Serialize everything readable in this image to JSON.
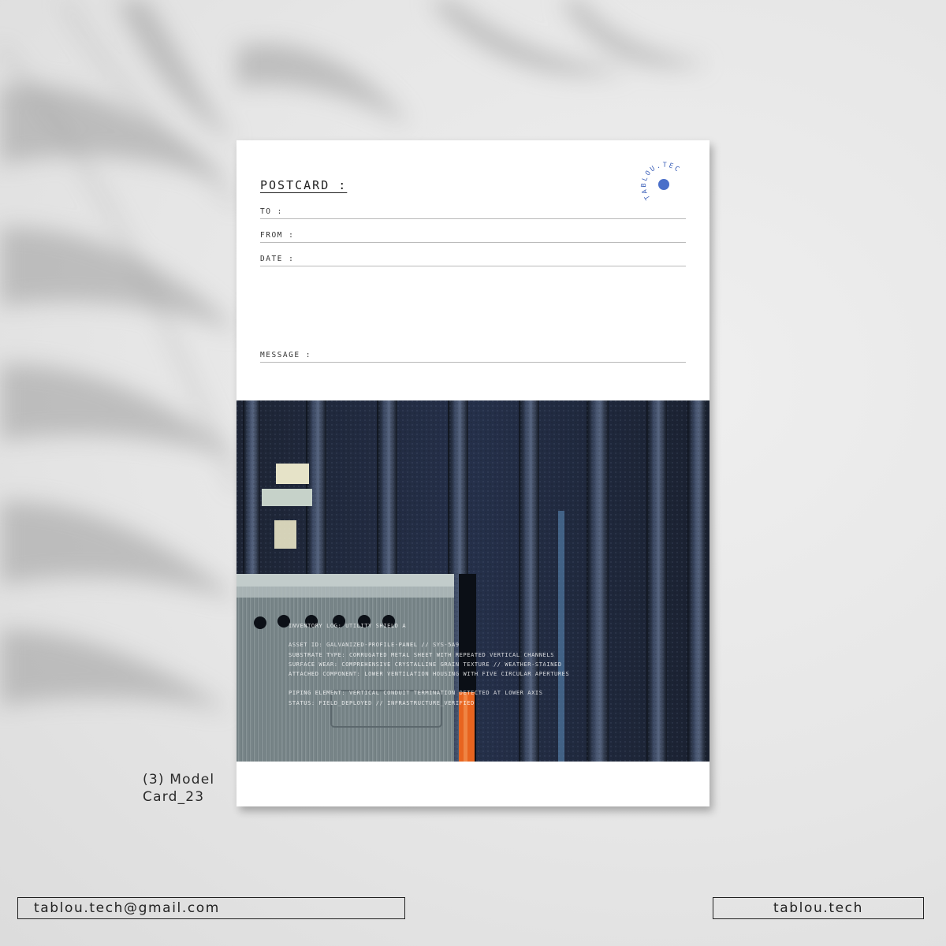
{
  "postcard": {
    "title": "POSTCARD :",
    "fields": {
      "to": "TO :",
      "from": "FROM :",
      "date": "DATE :",
      "message": "MESSAGE :"
    },
    "logo": {
      "text": "TABLOU.TECH",
      "dot_color": "#4a6fc9",
      "text_color": "#3b5fb8"
    }
  },
  "photo_overlay": {
    "line1": "INVENTORY LOG: UTILITY SHIELD A",
    "line2": "ASSET ID: GALVANIZED-PROFILE-PANEL // SYS-5A9",
    "line3": "SUBSTRATE TYPE: CORRUGATED METAL SHEET WITH REPEATED VERTICAL CHANNELS",
    "line4": "SURFACE WEAR: COMPREHENSIVE CRYSTALLINE GRAIN TEXTURE // WEATHER-STAINED",
    "line5": "ATTACHED COMPONENT: LOWER VENTILATION HOUSING WITH FIVE CIRCULAR APERTURES",
    "line6": "PIPING ELEMENT: VERTICAL CONDUIT TERMINATION DETECTED AT LOWER AXIS",
    "line7": "STATUS: FIELD_DEPLOYED // INFRASTRUCTURE_VERIFIED"
  },
  "caption": {
    "line1": "(3) Model",
    "line2": "Card_23"
  },
  "footer": {
    "email": "tablou.tech@gmail.com",
    "site": "tablou.tech"
  },
  "colors": {
    "background": "#e9e9e9",
    "card": "#ffffff",
    "wall": "#1e2636",
    "pipe": "#e8641f",
    "vent_box": "#8e9a9c"
  }
}
